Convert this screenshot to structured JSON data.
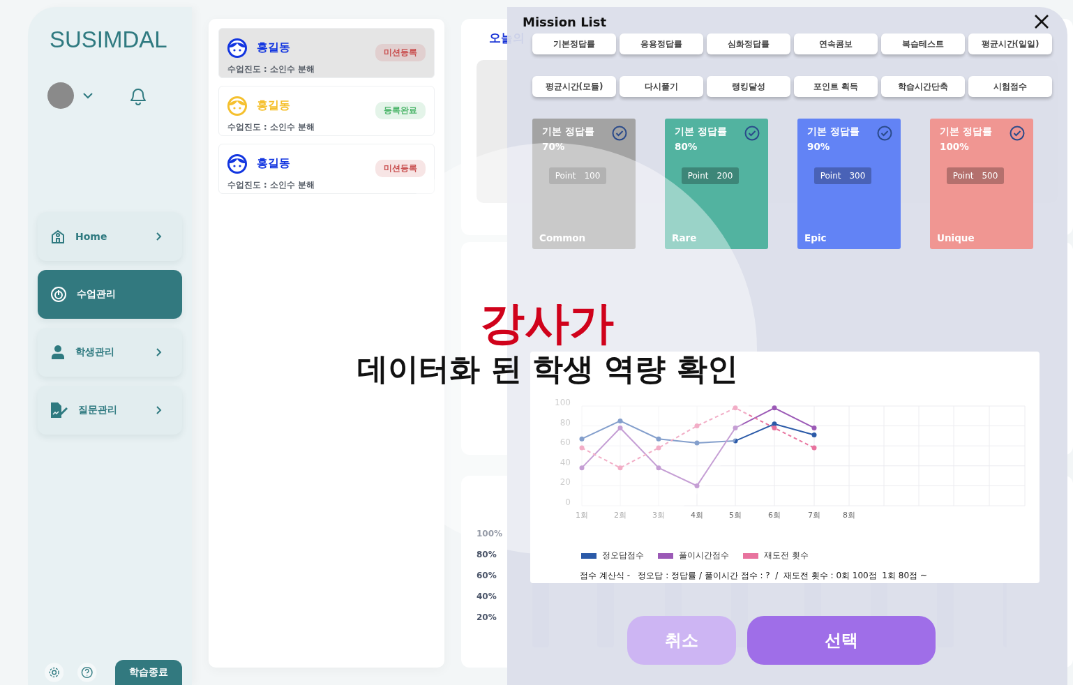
{
  "sidebar": {
    "logo": "SUSIMDAL",
    "nav": [
      {
        "kind": "home",
        "label": "Home",
        "selected": false
      },
      {
        "kind": "class",
        "label": "수업관리",
        "selected": true
      },
      {
        "kind": "student",
        "label": "학생관리",
        "selected": false
      },
      {
        "kind": "question",
        "label": "질문관리",
        "selected": false
      }
    ],
    "end_button": "학습종료"
  },
  "students": [
    {
      "name": "홍길동",
      "progress": "수업진도 : 소인수 분해",
      "status": {
        "text": "미션등록",
        "color": "#c95050"
      },
      "color": "#1336e0",
      "selected": true
    },
    {
      "name": "홍길동",
      "progress": "수업진도 : 소인수 분해",
      "status": {
        "text": "등록완료",
        "color": "#4cb56a"
      },
      "color": "#f5c02e",
      "selected": false
    },
    {
      "name": "홍길동",
      "progress": "수업진도 : 소인수 분해",
      "status": {
        "text": "미션등록",
        "color": "#c95050"
      },
      "color": "#1336e0",
      "selected": false
    }
  ],
  "background": {
    "tabs": [
      {
        "label": "오늘의",
        "selected": true
      }
    ],
    "bar_ticks": [
      "100%",
      "80%",
      "60%",
      "40%",
      "20%"
    ]
  },
  "modal": {
    "title": "Mission List",
    "missions": [
      "기본정답률",
      "응용정답률",
      "심화정답률",
      "연속콤보",
      "복습테스트",
      "평균시간(일일)",
      "평균시간(모듈)",
      "다시풀기",
      "랭킹달성",
      "포인트 획득",
      "학습시간단축",
      "시험점수"
    ],
    "cards": [
      {
        "title": "기본 정답률",
        "percent": "70%",
        "point_label": "Point",
        "point": "100",
        "rarity": "Common",
        "color": "#a3a3a3",
        "checked": true
      },
      {
        "title": "기본 정답률",
        "percent": "80%",
        "point_label": "Point",
        "point": "200",
        "rarity": "Rare",
        "color": "#52b3a0",
        "checked": true
      },
      {
        "title": "기본 정답률",
        "percent": "90%",
        "point_label": "Point",
        "point": "300",
        "rarity": "Epic",
        "color": "#6283f5",
        "checked": true
      },
      {
        "title": "기본 정답률",
        "percent": "100%",
        "point_label": "Point",
        "point": "500",
        "rarity": "Unique",
        "color": "#f09692",
        "checked": true
      }
    ],
    "chart_data": {
      "type": "line",
      "categories": [
        "1회",
        "2회",
        "3회",
        "4회",
        "5회",
        "6회",
        "7회",
        "8회"
      ],
      "ylim": [
        0,
        100
      ],
      "yticks": [
        0,
        20,
        40,
        60,
        80,
        100
      ],
      "grid": true,
      "series": [
        {
          "name": "정오답점수",
          "color": "#2b5aa8",
          "marker": true,
          "values": [
            67,
            85,
            67,
            63,
            65,
            82,
            71,
            null
          ]
        },
        {
          "name": "풀이시간점수",
          "color": "#9b59b6",
          "marker": true,
          "values": [
            38,
            78,
            38,
            20,
            78,
            98,
            78,
            null
          ]
        },
        {
          "name": "재도전 횟수",
          "color": "#e8739e",
          "marker": true,
          "line_style": "dashed",
          "values": [
            58,
            38,
            58,
            80,
            98,
            78,
            58,
            null
          ]
        }
      ]
    },
    "formula": "점수 계산식 -   정오답 : 정답률 / 풀이시간 점수 : ?  /  재도전 횟수 : 0회 100점  1회 80점 ~",
    "cancel": "취소",
    "confirm": "선택"
  },
  "headline": {
    "accent": "강사가",
    "main": "데이터화 된 학생 역량 확인"
  }
}
